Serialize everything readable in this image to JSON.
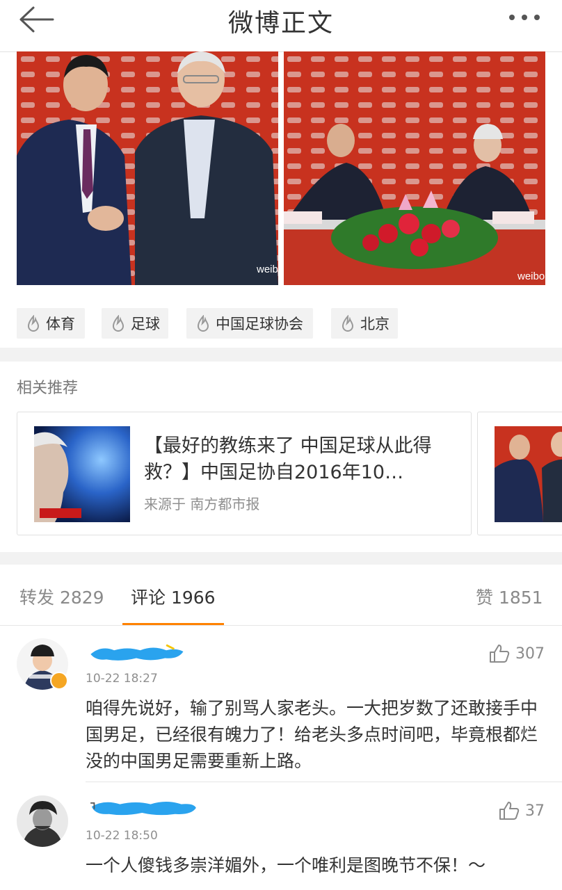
{
  "header": {
    "title": "微博正文"
  },
  "photos": {
    "watermark": "weibo.com"
  },
  "tags": [
    "体育",
    "足球",
    "中国足球协会",
    "北京"
  ],
  "related": {
    "title": "相关推荐",
    "card": {
      "headline": "【最好的教练来了 中国足球从此得救？】中国足协自2016年10…",
      "source": "来源于 南方都市报"
    }
  },
  "stats": {
    "repost": "转发 2829",
    "comment": "评论 1966",
    "like": "赞 1851"
  },
  "comments": [
    {
      "time": "10-22 18:27",
      "likes": "307",
      "text": "咱得先说好，输了别骂人家老头。一大把岁数了还敢接手中国男足，已经很有魄力了！给老头多点时间吧，毕竟根都烂没的中国男足需要重新上路。"
    },
    {
      "time": "10-22 18:50",
      "likes": "37",
      "text": "一个人傻钱多崇洋媚外，一个唯利是图晚节不保！～"
    }
  ],
  "colors": {
    "accent": "#ff8200",
    "gap": "#f2f2f2",
    "blur": "#2aa3ee"
  }
}
